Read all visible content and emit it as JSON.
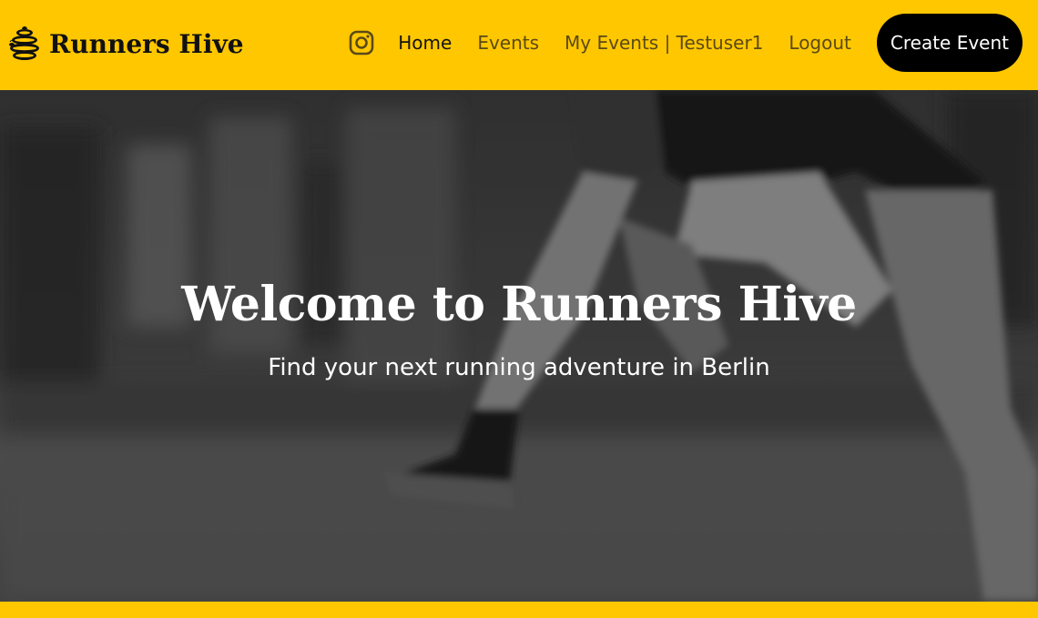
{
  "brand": {
    "name": "Runners Hive",
    "logo_icon": "beehive-icon"
  },
  "nav": {
    "instagram_icon": "instagram-icon",
    "links": [
      {
        "label": "Home",
        "active": true
      },
      {
        "label": "Events",
        "active": false
      },
      {
        "label": "My Events | Testuser1",
        "active": false
      },
      {
        "label": "Logout",
        "active": false
      }
    ],
    "create_button": "Create Event"
  },
  "hero": {
    "title": "Welcome to Runners Hive",
    "subtitle": "Find your next running adventure in Berlin",
    "background": "blurred-runners-photo"
  },
  "colors": {
    "brand_yellow": "#ffc700",
    "nav_text": "#5a4a17",
    "nav_active": "#141414",
    "button_bg": "#000000",
    "button_text": "#ffffff"
  }
}
